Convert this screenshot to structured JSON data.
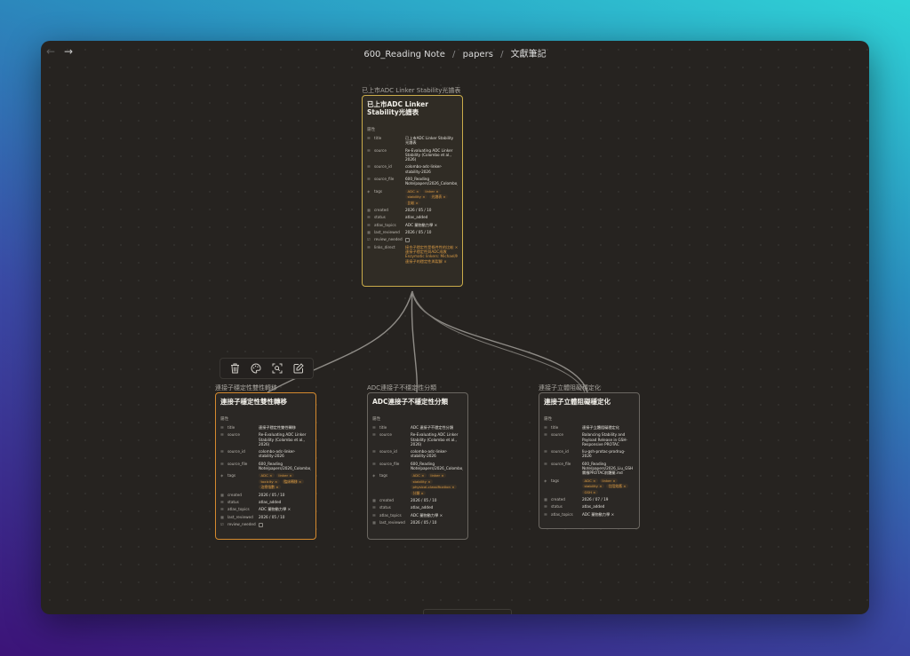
{
  "window": {
    "breadcrumb": [
      "600_Reading Note",
      "papers",
      "文獻筆記"
    ],
    "breadcrumb_sep": "/",
    "back_icon": "arrow-left-icon",
    "forward_icon": "arrow-right-icon"
  },
  "toolbar": {
    "buttons": [
      {
        "icon": "trash-icon"
      },
      {
        "icon": "palette-icon"
      },
      {
        "icon": "zoom-to-selection-icon"
      },
      {
        "icon": "edit-icon"
      }
    ]
  },
  "colors": {
    "canvas": "#262320",
    "yellow_border": "#c9ab4a",
    "orange_border": "#d58a2e",
    "tag_text": "#d99a44",
    "edge": "#8f8c87"
  },
  "properties_label": "屬性",
  "nodes": {
    "top": {
      "label": "已上市ADC Linker Stability光譜表",
      "title": "已上市ADC Linker Stability光譜表",
      "props": {
        "title_k": "title",
        "title_v": "已上市ADC Linker Stability 光譜表",
        "source_k": "source",
        "source_v": "Re-Evaluating ADC Linker Stability (Colombo et al., 2026)",
        "source_id_k": "source_id",
        "source_id_v": "colombo-adc-linker-stability-2026",
        "source_file_k": "source_file",
        "source_file_v": "600_Reading Note/papers/2026_Colombo_r",
        "tags_k": "tags",
        "tags": [
          "ADC ×",
          "linker ×",
          "stability ×",
          "光譜表 ×",
          "比較 ×"
        ],
        "created_k": "created",
        "created_v": "2026 / 05 / 10",
        "status_k": "status",
        "status_v": "atlas_added",
        "atlas_topics_k": "atlas_topics",
        "atlas_topics_v": "ADC 藥物動力學 ×",
        "last_reviewed_k": "last_reviewed",
        "last_reviewed_v": "2026 / 05 / 10",
        "review_needed_k": "review_needed",
        "links_direct_k": "links_direct",
        "links": [
          "接合子穩定性是條件性的比較 ×",
          "連接子穩定性與ADC成敗",
          "Enzymatic linkers: Michael/Maleimide 比較 ×",
          "連接子的穩定性與裂解 ×"
        ]
      }
    },
    "left": {
      "label": "連接子穩定性雙性轉移",
      "title": "連接子穩定性雙性轉移",
      "props": {
        "title_k": "title",
        "title_v": "連接子穩定性雙性轉移",
        "source_k": "source",
        "source_v": "Re-Evaluating ADC Linker Stability (Colombo et al., 2026)",
        "source_id_k": "source_id",
        "source_id_v": "colombo-adc-linker-stability-2026",
        "source_file_k": "source_file",
        "source_file_v": "600_Reading Note/papers/2026_Colombo_r",
        "tags_k": "tags",
        "tags": [
          "ADC ×",
          "linker ×",
          "toxicity ×",
          "臨床轉移 ×",
          "治療指數 ×"
        ],
        "created_k": "created",
        "created_v": "2026 / 05 / 10",
        "status_k": "status",
        "status_v": "atlas_added",
        "atlas_topics_k": "atlas_topics",
        "atlas_topics_v": "ADC 藥物動力學 ×",
        "last_reviewed_k": "last_reviewed",
        "last_reviewed_v": "2026 / 05 / 10",
        "review_needed_k": "review_needed"
      }
    },
    "mid": {
      "label": "ADC連接子不穩定性分類",
      "title": "ADC連接子不穩定性分類",
      "props": {
        "title_k": "title",
        "title_v": "ADC 連接子不穩定性分類",
        "source_k": "source",
        "source_v": "Re-Evaluating ADC Linker Stability (Colombo et al., 2026)",
        "source_id_k": "source_id",
        "source_id_v": "colombo-adc-linker-stability-2026",
        "source_file_k": "source_file",
        "source_file_v": "600_Reading Note/papers/2026_Colombo_r",
        "tags_k": "tags",
        "tags": [
          "ADC ×",
          "linker ×",
          "stability ×",
          "physical-classification ×",
          "分類 ×"
        ],
        "created_k": "created",
        "created_v": "2026 / 05 / 10",
        "status_k": "status",
        "status_v": "atlas_added",
        "atlas_topics_k": "atlas_topics",
        "atlas_topics_v": "ADC 藥物動力學 ×",
        "last_reviewed_k": "last_reviewed",
        "last_reviewed_v": "2026 / 05 / 10"
      }
    },
    "right": {
      "label": "連接子立體阻礙穩定化",
      "title": "連接子立體阻礙穩定化",
      "props": {
        "title_k": "title",
        "title_v": "連接子立體阻礙穩定化",
        "source_k": "source",
        "source_v": "Balancing Stability and Payload Release in GSH-Responsive PROTAC",
        "source_id_k": "source_id",
        "source_id_v": "liu-gsh-protac-prodrug-2026",
        "source_file_k": "source_file",
        "source_file_v": "600_Reading Note/papers/2026_Liu_GSH 響應PROTAC前體藥.md",
        "tags_k": "tags",
        "tags": [
          "ADC ×",
          "linker ×",
          "stability ×",
          "位阻效應 ×",
          "GSH ×"
        ],
        "created_k": "created",
        "created_v": "2026 / 07 / 19",
        "status_k": "status",
        "status_v": "atlas_added",
        "atlas_topics_k": "atlas_topics",
        "atlas_topics_v": "ADC 藥物動力學 ×"
      }
    }
  }
}
